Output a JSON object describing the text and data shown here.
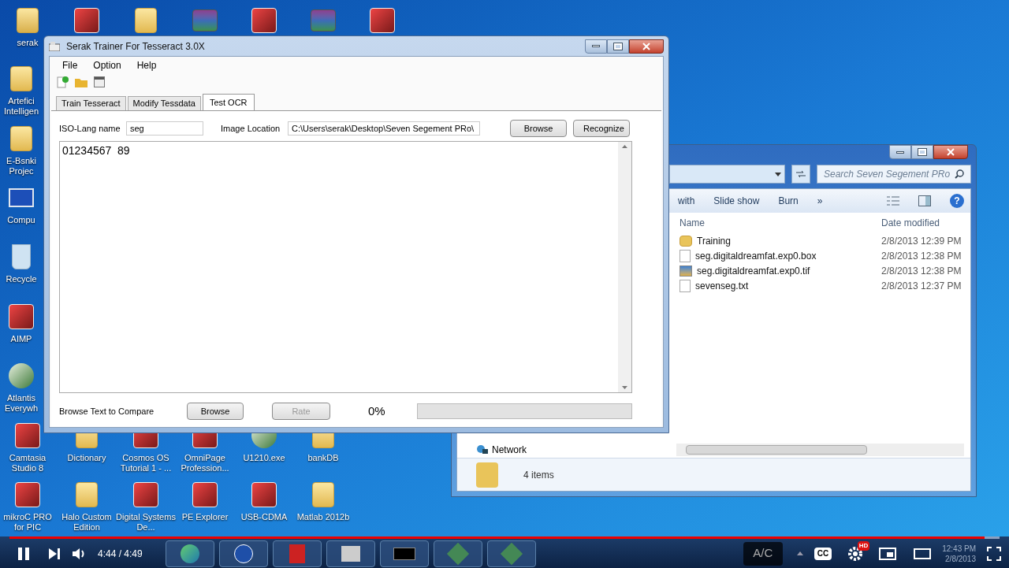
{
  "desktop_icons": [
    {
      "label": "serak",
      "kind": "user-folder"
    },
    {
      "kind": "app"
    },
    {
      "kind": "folder"
    },
    {
      "kind": "archive"
    },
    {
      "kind": "app"
    },
    {
      "kind": "archive"
    },
    {
      "kind": "app"
    },
    {
      "label": "Artefici Intelligen",
      "kind": "folder"
    },
    {
      "label": "E-Bsnki Projec",
      "kind": "folder"
    },
    {
      "label": "Compu",
      "kind": "computer"
    },
    {
      "label": "Recycle",
      "kind": "bin"
    },
    {
      "label": "AIMP",
      "kind": "app"
    },
    {
      "label": "Atlantis Everywh",
      "kind": "globe"
    },
    {
      "label": "Camtasia Studio 8",
      "kind": "app"
    },
    {
      "label": "Dictionary",
      "kind": "folder"
    },
    {
      "label": "Cosmos OS Tutorial 1 - ...",
      "kind": "app"
    },
    {
      "label": "OmniPage Profession...",
      "kind": "app"
    },
    {
      "label": "U1210.exe",
      "kind": "globe"
    },
    {
      "label": "bankDB",
      "kind": "folder"
    },
    {
      "label": "mikroC PRO for PIC",
      "kind": "app"
    },
    {
      "label": "Halo Custom Edition",
      "kind": "folder"
    },
    {
      "label": "Digital Systems De...",
      "kind": "app"
    },
    {
      "label": "PE Explorer",
      "kind": "app"
    },
    {
      "label": "USB-CDMA",
      "kind": "app"
    },
    {
      "label": "Matlab 2012b",
      "kind": "folder"
    }
  ],
  "explorer": {
    "search": {
      "placeholder": "Search Seven Segement PRo"
    },
    "toolbar": [
      "with",
      "Slide show",
      "Burn",
      "»"
    ],
    "columns": [
      "Name",
      "Date modified"
    ],
    "files": [
      {
        "name": "Training",
        "date": "2/8/2013 12:39 PM",
        "kind": "folder"
      },
      {
        "name": "seg.digitaldreamfat.exp0.box",
        "date": "2/8/2013 12:38 PM",
        "kind": "file"
      },
      {
        "name": "seg.digitaldreamfat.exp0.tif",
        "date": "2/8/2013 12:38 PM",
        "kind": "image"
      },
      {
        "name": "sevenseg.txt",
        "date": "2/8/2013 12:37 PM",
        "kind": "file"
      }
    ],
    "help": "?",
    "nav_item": "Network",
    "status": "4 items"
  },
  "app": {
    "title": "Serak Trainer For Tesseract 3.0X",
    "menu": [
      "File",
      "Option",
      "Help"
    ],
    "tabs": [
      {
        "label": "Train Tesseract",
        "selected": false
      },
      {
        "label": "Modify Tessdata",
        "selected": false
      },
      {
        "label": "Test OCR",
        "selected": true
      }
    ],
    "lang_label": "ISO-Lang name",
    "lang_value": "seg",
    "location_label": "Image Location",
    "location_value": "C:\\Users\\serak\\Desktop\\Seven Segement PRo\\",
    "browse": "Browse",
    "recognize": "Recognize",
    "output": "01234567  89",
    "compare_label": "Browse Text to Compare",
    "compare_browse": "Browse",
    "rate": {
      "label": "Rate",
      "disabled": true
    },
    "percent": "0%",
    "progress": {
      "level": 0
    }
  },
  "player": {
    "time": "4:44 / 4:49",
    "level": 0.985,
    "ac": "A/C",
    "cc": "CC",
    "hd": "HD",
    "clock": "12:43 PM",
    "date": "2/8/2013"
  }
}
